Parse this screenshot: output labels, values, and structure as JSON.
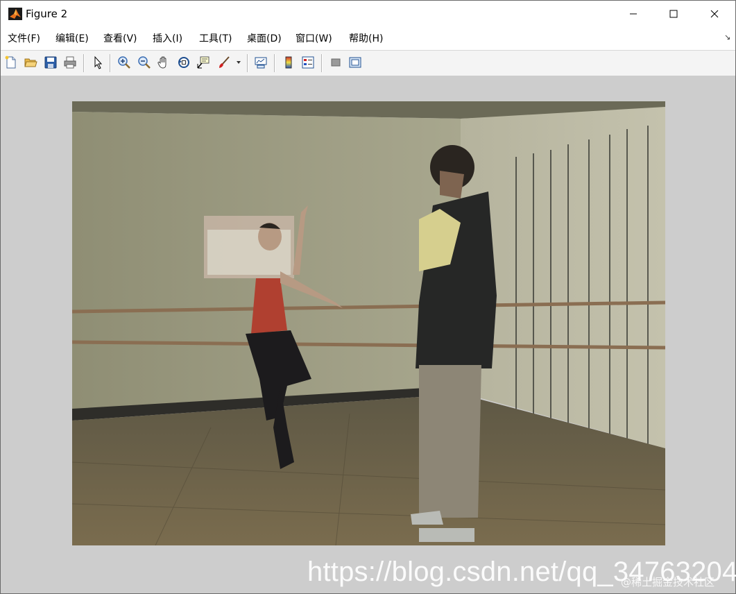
{
  "window": {
    "title": "Figure 2",
    "icon": "matlab-icon",
    "controls": [
      "minimize-icon",
      "maximize-icon",
      "close-icon"
    ]
  },
  "menu": {
    "items": [
      {
        "label": "文件(F)"
      },
      {
        "label": "编辑(E)"
      },
      {
        "label": "查看(V)"
      },
      {
        "label": "插入(I)"
      },
      {
        "label": "工具(T)"
      },
      {
        "label": "桌面(D)"
      },
      {
        "label": "窗口(W)"
      },
      {
        "label": "帮助(H)"
      }
    ],
    "dock_arrow": "↘"
  },
  "toolbar": {
    "buttons": [
      "new-figure-icon",
      "open-file-icon",
      "save-icon",
      "print-icon",
      "select-arrow-icon",
      "zoom-in-icon",
      "zoom-out-icon",
      "pan-hand-icon",
      "rotate-3d-icon",
      "data-cursor-icon",
      "brush-icon",
      "brush-dropdown-icon",
      "link-plot-icon",
      "colorbar-icon",
      "legend-icon",
      "hide-plot-tools-icon",
      "show-plot-tools-icon"
    ]
  },
  "figure": {
    "background": "#cdcdcd",
    "image_description_colors": {
      "wall": "#9b9a7f",
      "floor": "#6e6448",
      "barre": "#8a6e52"
    }
  },
  "watermark": {
    "url": "https://blog.csdn.net/qq_34763204",
    "site": "@稀土掘金技术社区"
  }
}
